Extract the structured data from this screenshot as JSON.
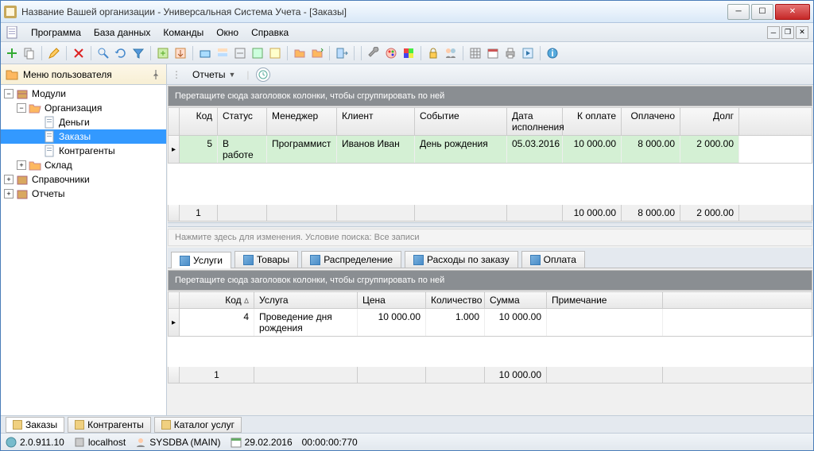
{
  "window": {
    "title": "Название Вашей организации - Универсальная Система Учета - [Заказы]"
  },
  "menu": {
    "program": "Программа",
    "database": "База данных",
    "commands": "Команды",
    "window": "Окно",
    "help": "Справка"
  },
  "user_menu": {
    "header": "Меню пользователя"
  },
  "reports_btn": "Отчеты",
  "tree": {
    "modules": "Модули",
    "organization": "Организация",
    "money": "Деньги",
    "orders": "Заказы",
    "counterparties": "Контрагенты",
    "warehouse": "Склад",
    "directories": "Справочники",
    "reports": "Отчеты"
  },
  "group_hint": "Перетащите сюда заголовок колонки, чтобы сгруппировать по ней",
  "orders_grid": {
    "headers": {
      "code": "Код",
      "status": "Статус",
      "manager": "Менеджер",
      "client": "Клиент",
      "event": "Событие",
      "date": "Дата исполнения",
      "to_pay": "К оплате",
      "paid": "Оплачено",
      "debt": "Долг"
    },
    "rows": [
      {
        "code": "5",
        "status": "В работе",
        "manager": "Программист",
        "client": "Иванов Иван",
        "event": "День рождения",
        "date": "05.03.2016",
        "to_pay": "10 000.00",
        "paid": "8 000.00",
        "debt": "2 000.00"
      }
    ],
    "totals": {
      "count": "1",
      "to_pay": "10 000.00",
      "paid": "8 000.00",
      "debt": "2 000.00"
    }
  },
  "search_hint": "Нажмите здесь для изменения. Условие поиска: Все записи",
  "detail_tabs": {
    "services": "Услуги",
    "goods": "Товары",
    "distribution": "Распределение",
    "expenses": "Расходы по заказу",
    "payment": "Оплата"
  },
  "services_grid": {
    "headers": {
      "code": "Код",
      "service": "Услуга",
      "price": "Цена",
      "qty": "Количество",
      "sum": "Сумма",
      "note": "Примечание"
    },
    "rows": [
      {
        "code": "4",
        "service": "Проведение дня рождения",
        "price": "10 000.00",
        "qty": "1.000",
        "sum": "10 000.00",
        "note": ""
      }
    ],
    "totals": {
      "count": "1",
      "sum": "10 000.00"
    }
  },
  "bottom_tabs": {
    "orders": "Заказы",
    "counterparties": "Контрагенты",
    "service_catalog": "Каталог услуг"
  },
  "status": {
    "version": "2.0.911.10",
    "host": "localhost",
    "user": "SYSDBA (MAIN)",
    "date": "29.02.2016",
    "time": "00:00:00:770"
  }
}
